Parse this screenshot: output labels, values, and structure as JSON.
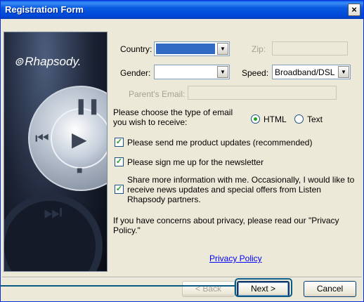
{
  "window": {
    "title": "Registration Form",
    "close_glyph": "×"
  },
  "art": {
    "logo_text": "Rhapsody.",
    "logo_icon": "rhapsody-logo-icon"
  },
  "form": {
    "country": {
      "label": "Country:",
      "value": ""
    },
    "zip": {
      "label": "Zip:",
      "value": ""
    },
    "gender": {
      "label": "Gender:",
      "value": ""
    },
    "speed": {
      "label": "Speed:",
      "value": "Broadband/DSL"
    },
    "parents_email": {
      "label": "Parent's Email:",
      "value": ""
    },
    "email_type": {
      "prompt": "Please choose the type of email you wish to receive:",
      "options": [
        {
          "label": "HTML",
          "selected": true
        },
        {
          "label": "Text",
          "selected": false
        }
      ]
    },
    "checkboxes": [
      {
        "label": "Please send me product updates (recommended)",
        "checked": true
      },
      {
        "label": "Please sign me up for the newsletter",
        "checked": true
      },
      {
        "label": "Share more information with me.  Occasionally, I would like to receive news updates and special offers from Listen Rhapsody partners.",
        "checked": true
      }
    ],
    "privacy_text": "If you have concerns about privacy, please read our \"Privacy Policy.\"",
    "privacy_link": "Privacy Policy"
  },
  "buttons": {
    "back": "< Back",
    "next": "Next >",
    "cancel": "Cancel"
  },
  "colors": {
    "titlebar": "#0054e3",
    "dialog_bg": "#ece9d8",
    "callout": "#0b5c84",
    "check": "#21a121"
  }
}
